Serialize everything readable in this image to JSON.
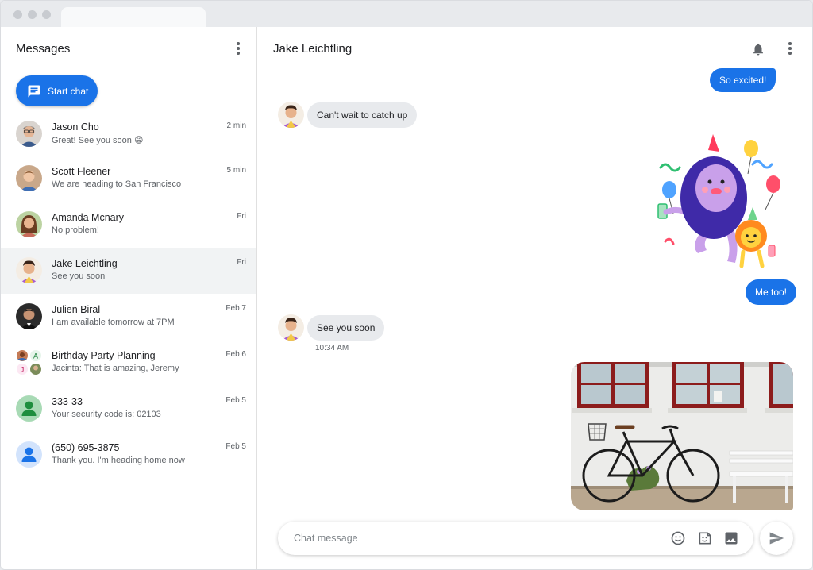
{
  "sidebar": {
    "title": "Messages",
    "start_chat_label": "Start chat",
    "conversations": [
      {
        "name": "Jason Cho",
        "snippet": "Great! See you soon",
        "emoji": "😄",
        "time": "2 min"
      },
      {
        "name": "Scott Fleener",
        "snippet": "We are heading to San Francisco",
        "time": "5 min"
      },
      {
        "name": "Amanda Mcnary",
        "snippet": "No problem!",
        "time": "Fri"
      },
      {
        "name": "Jake Leichtling",
        "snippet": "See you soon",
        "time": "Fri",
        "selected": true
      },
      {
        "name": "Julien Biral",
        "snippet": "I am available tomorrow at 7PM",
        "time": "Feb 7"
      },
      {
        "name": "Birthday Party Planning",
        "snippet": "Jacinta: That is amazing, Jeremy",
        "time": "Feb 6",
        "group_initials": [
          "A",
          "J"
        ]
      },
      {
        "name": "333-33",
        "snippet": "Your security code is: 02103",
        "time": "Feb 5"
      },
      {
        "name": "(650) 695-3875",
        "snippet": "Thank you. I'm heading home now",
        "time": "Feb 5"
      }
    ]
  },
  "chat": {
    "title": "Jake Leichtling",
    "messages": [
      {
        "direction": "out",
        "text": "So excited!"
      },
      {
        "direction": "in",
        "text": "Can't wait to catch up"
      },
      {
        "direction": "out",
        "type": "sticker",
        "sticker": "party-monster-sticker"
      },
      {
        "direction": "out",
        "text": "Me too!"
      },
      {
        "direction": "in",
        "text": "See you soon",
        "time": "10:34 AM"
      },
      {
        "direction": "out",
        "type": "image",
        "image": "bicycle-photo"
      }
    ],
    "composer_placeholder": "Chat message"
  },
  "icons": {
    "start_chat": "chat-bubble-icon",
    "menu": "more-vert-icon",
    "notifications": "bell-icon",
    "emoji": "emoji-icon",
    "sticker": "sticker-icon",
    "image": "image-icon",
    "send": "send-icon"
  },
  "colors": {
    "accent": "#1a73e8",
    "incoming_bubble": "#e8eaed",
    "selected_row": "#f1f3f4"
  }
}
